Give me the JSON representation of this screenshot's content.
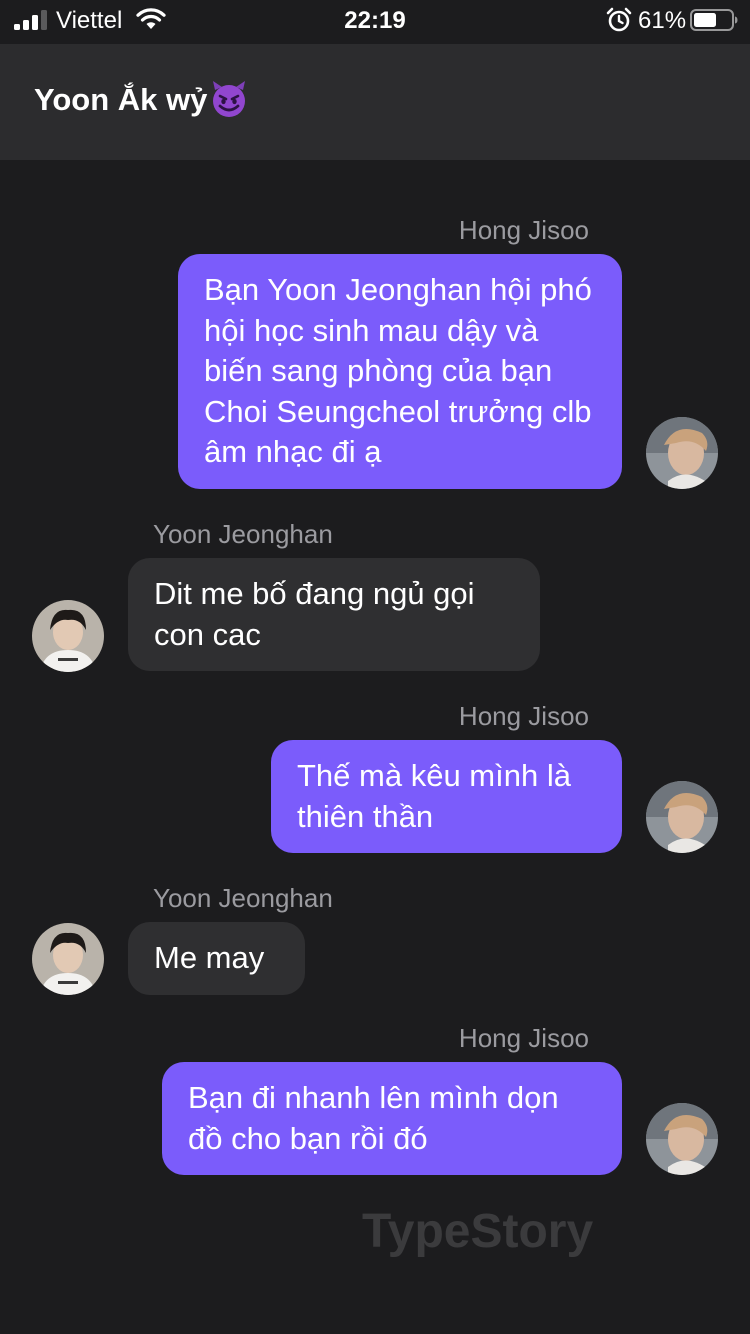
{
  "status_bar": {
    "carrier": "Viettel",
    "time": "22:19",
    "battery_percent": "61%",
    "battery_level": 0.61
  },
  "chat": {
    "title": "Yoon Ắk wỷ",
    "title_emoji": "smiling-devil-icon"
  },
  "messages": [
    {
      "sender": "Hong Jisoo",
      "direction": "outgoing",
      "text": "Bạn Yoon Jeonghan hội phó hội học sinh mau dậy và biến sang phòng của bạn Choi Seungcheol trưởng clb âm nhạc đi ạ"
    },
    {
      "sender": "Yoon Jeonghan",
      "direction": "incoming",
      "text": "Dit me bố đang ngủ gọi con cac"
    },
    {
      "sender": "Hong Jisoo",
      "direction": "outgoing",
      "text": "Thế mà kêu mình là thiên thần"
    },
    {
      "sender": "Yoon Jeonghan",
      "direction": "incoming",
      "text": "Me may"
    },
    {
      "sender": "Hong Jisoo",
      "direction": "outgoing",
      "text": "Bạn đi nhanh lên mình dọn đồ cho bạn rồi đó"
    }
  ],
  "watermark": "TypeStory",
  "colors": {
    "background": "#1c1c1e",
    "header": "#2c2c2e",
    "outgoing_bubble": "#7b5cfb",
    "incoming_bubble": "#2f2f31",
    "sender_name": "#9b9ba0"
  }
}
